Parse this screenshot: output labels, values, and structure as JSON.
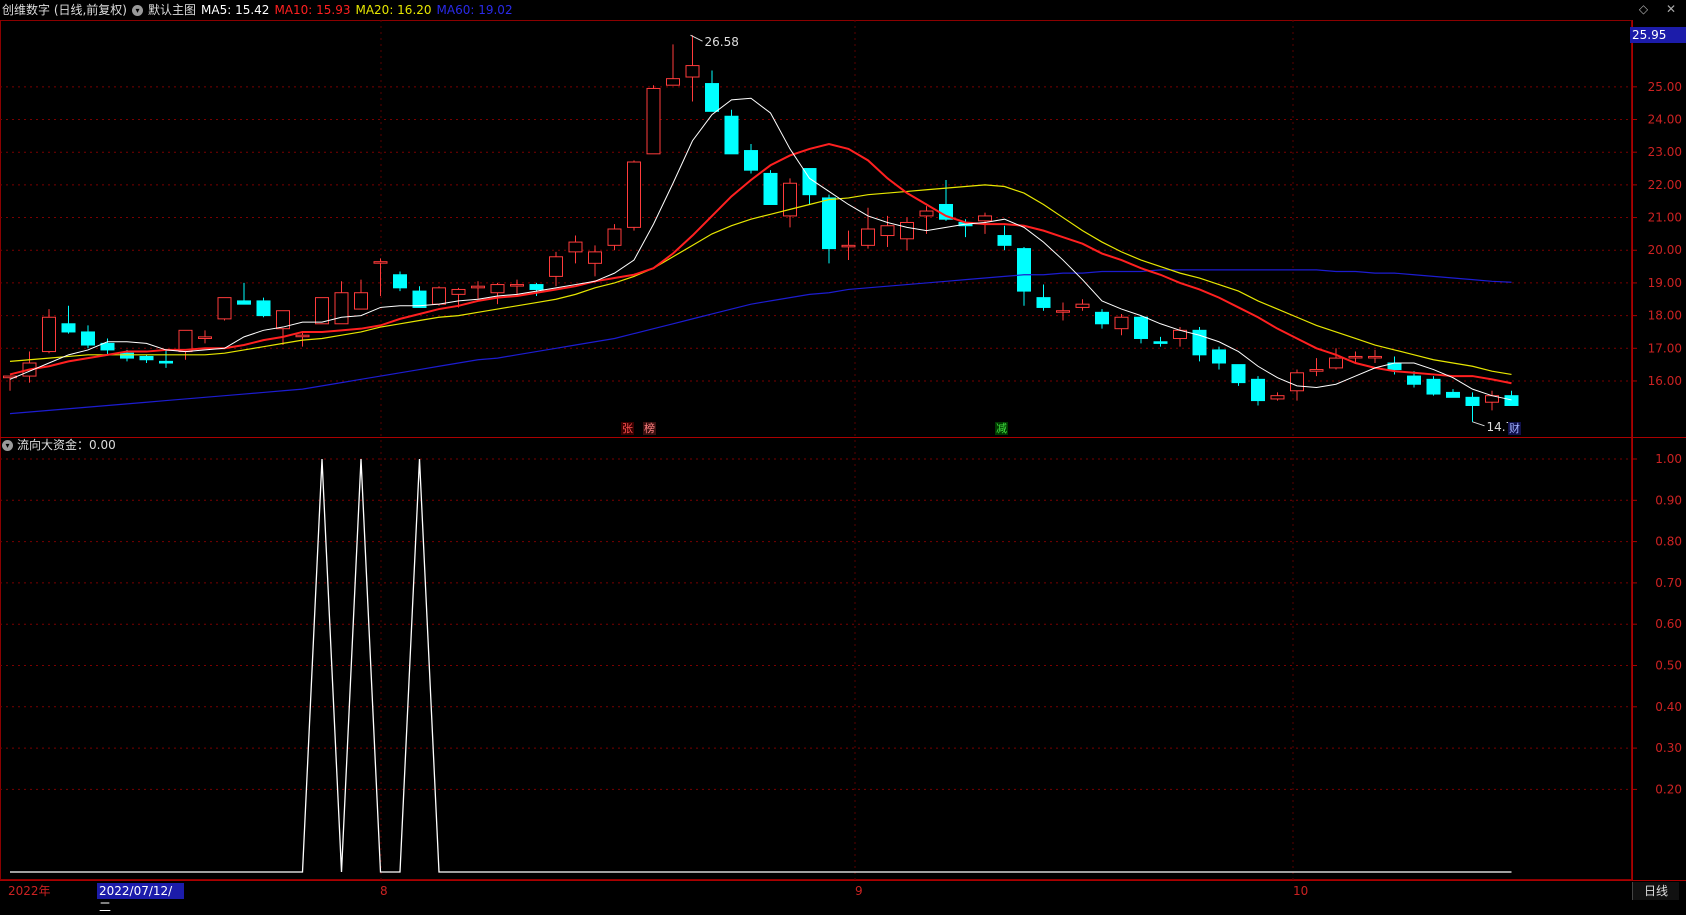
{
  "header": {
    "title": "创维数字 (日线,前复权)",
    "template": "默认主图",
    "ma5": {
      "label": "MA5: 15.42",
      "color": "#ffffff"
    },
    "ma10": {
      "label": "MA10: 15.93",
      "color": "#ff2020"
    },
    "ma20": {
      "label": "MA20: 16.20",
      "color": "#e6e600"
    },
    "ma60": {
      "label": "MA60: 19.02",
      "color": "#2020e0"
    },
    "right_icons": [
      "diamond-icon",
      "close-icon"
    ]
  },
  "sub_indicator": {
    "label": "流向大资金：0.00"
  },
  "price_axis": {
    "current_badge": "25.95",
    "ticks": [
      "25.00",
      "24.00",
      "23.00",
      "22.00",
      "21.00",
      "20.00",
      "19.00",
      "18.00",
      "17.00",
      "16.00"
    ]
  },
  "sub_axis": {
    "ticks": [
      "1.00",
      "0.90",
      "0.80",
      "0.70",
      "0.60",
      "0.50",
      "0.40",
      "0.30",
      "0.20"
    ]
  },
  "annotations": {
    "high": "26.58",
    "low": "14.75",
    "events": [
      {
        "text": "张",
        "color": "#ff5050",
        "bg": "#3a0000"
      },
      {
        "text": "榜",
        "color": "#ff8080",
        "bg": "#3a1010"
      },
      {
        "text": "减",
        "color": "#40e040",
        "bg": "#003a00"
      },
      {
        "text": "财",
        "color": "#a0b0ff",
        "bg": "#10104a"
      }
    ]
  },
  "date_axis": {
    "year": "2022年",
    "cursor_date": "2022/07/12/二",
    "months": [
      "8",
      "9",
      "10"
    ]
  },
  "period_tab": "日线",
  "chart_data": {
    "type": "candlestick",
    "colors": {
      "up": "#ff3b3b",
      "down": "#00ffff",
      "ma5": "#ffffff",
      "ma10": "#ff2020",
      "ma20": "#e6e600",
      "ma60": "#1c1cd0"
    },
    "candles": [
      [
        16.1,
        16.15,
        15.7,
        16.15
      ],
      [
        16.15,
        16.9,
        15.95,
        16.55
      ],
      [
        16.9,
        18.2,
        16.85,
        17.95
      ],
      [
        17.75,
        18.3,
        17.45,
        17.5
      ],
      [
        17.5,
        17.7,
        17.0,
        17.1
      ],
      [
        17.15,
        17.3,
        16.8,
        16.95
      ],
      [
        16.85,
        16.95,
        16.6,
        16.7
      ],
      [
        16.75,
        16.8,
        16.55,
        16.65
      ],
      [
        16.6,
        16.95,
        16.4,
        16.55
      ],
      [
        16.9,
        17.55,
        16.65,
        17.55
      ],
      [
        17.3,
        17.55,
        17.15,
        17.35
      ],
      [
        17.9,
        18.55,
        17.85,
        18.55
      ],
      [
        18.45,
        19.0,
        18.35,
        18.35
      ],
      [
        18.45,
        18.55,
        17.95,
        18.0
      ],
      [
        17.6,
        18.15,
        17.1,
        18.15
      ],
      [
        17.4,
        17.5,
        17.05,
        17.4
      ],
      [
        17.75,
        18.55,
        17.75,
        18.55
      ],
      [
        17.75,
        19.05,
        17.75,
        18.7
      ],
      [
        18.2,
        19.1,
        18.2,
        18.7
      ],
      [
        19.65,
        19.75,
        18.6,
        19.65
      ],
      [
        19.25,
        19.35,
        18.75,
        18.85
      ],
      [
        18.75,
        18.9,
        18.3,
        18.25
      ],
      [
        18.35,
        18.9,
        18.3,
        18.85
      ],
      [
        18.65,
        18.85,
        18.25,
        18.8
      ],
      [
        18.85,
        19.05,
        18.5,
        18.9
      ],
      [
        18.7,
        19.0,
        18.35,
        18.95
      ],
      [
        18.95,
        19.1,
        18.6,
        18.95
      ],
      [
        18.95,
        19.0,
        18.6,
        18.8
      ],
      [
        19.2,
        19.95,
        18.9,
        19.8
      ],
      [
        19.95,
        20.45,
        19.6,
        20.25
      ],
      [
        19.6,
        20.15,
        19.2,
        19.95
      ],
      [
        20.15,
        20.8,
        20.0,
        20.65
      ],
      [
        20.7,
        22.75,
        20.6,
        22.7
      ],
      [
        22.95,
        25.05,
        22.95,
        24.95
      ],
      [
        25.05,
        26.3,
        25.05,
        25.25
      ],
      [
        25.3,
        26.58,
        24.55,
        25.65
      ],
      [
        25.1,
        25.5,
        24.45,
        24.25
      ],
      [
        24.1,
        24.3,
        23.1,
        22.95
      ],
      [
        23.05,
        23.25,
        22.35,
        22.45
      ],
      [
        22.35,
        22.45,
        21.4,
        21.4
      ],
      [
        21.05,
        22.2,
        20.7,
        22.05
      ],
      [
        22.5,
        22.5,
        21.4,
        21.7
      ],
      [
        21.6,
        21.7,
        19.6,
        20.05
      ],
      [
        20.15,
        20.6,
        19.7,
        20.15
      ],
      [
        20.15,
        21.3,
        20.05,
        20.65
      ],
      [
        20.45,
        21.05,
        20.1,
        20.75
      ],
      [
        20.35,
        21.0,
        20.0,
        20.85
      ],
      [
        21.05,
        21.35,
        20.5,
        21.2
      ],
      [
        21.4,
        22.15,
        20.9,
        20.95
      ],
      [
        20.85,
        20.95,
        20.4,
        20.75
      ],
      [
        20.9,
        21.15,
        20.5,
        21.05
      ],
      [
        20.45,
        20.75,
        20.0,
        20.15
      ],
      [
        20.05,
        20.1,
        18.3,
        18.75
      ],
      [
        18.55,
        18.95,
        18.15,
        18.25
      ],
      [
        18.15,
        18.4,
        17.85,
        18.15
      ],
      [
        18.25,
        18.5,
        18.15,
        18.35
      ],
      [
        18.1,
        18.2,
        17.6,
        17.75
      ],
      [
        17.6,
        18.05,
        17.4,
        17.95
      ],
      [
        17.95,
        18.0,
        17.15,
        17.3
      ],
      [
        17.2,
        17.35,
        17.05,
        17.15
      ],
      [
        17.3,
        17.65,
        17.05,
        17.55
      ],
      [
        17.55,
        17.65,
        16.6,
        16.8
      ],
      [
        16.95,
        17.05,
        16.35,
        16.55
      ],
      [
        16.5,
        16.5,
        15.85,
        15.95
      ],
      [
        16.05,
        16.15,
        15.25,
        15.4
      ],
      [
        15.45,
        15.65,
        15.4,
        15.55
      ],
      [
        15.7,
        16.35,
        15.4,
        16.25
      ],
      [
        16.3,
        16.7,
        16.15,
        16.35
      ],
      [
        16.4,
        17.0,
        16.35,
        16.7
      ],
      [
        16.75,
        16.9,
        16.55,
        16.75
      ],
      [
        16.75,
        16.95,
        16.55,
        16.75
      ],
      [
        16.55,
        16.75,
        16.2,
        16.35
      ],
      [
        16.15,
        16.3,
        15.8,
        15.9
      ],
      [
        16.05,
        16.15,
        15.55,
        15.6
      ],
      [
        15.65,
        15.75,
        15.5,
        15.5
      ],
      [
        15.5,
        15.65,
        14.75,
        15.25
      ],
      [
        15.35,
        15.7,
        15.1,
        15.55
      ],
      [
        15.55,
        15.7,
        15.25,
        15.25
      ]
    ],
    "ma5": [
      16.05,
      16.3,
      16.55,
      16.8,
      16.95,
      17.2,
      17.2,
      17.15,
      16.95,
      16.9,
      16.95,
      17.0,
      17.35,
      17.55,
      17.65,
      17.8,
      17.8,
      17.95,
      18.0,
      18.25,
      18.3,
      18.3,
      18.35,
      18.45,
      18.5,
      18.6,
      18.65,
      18.75,
      18.85,
      18.95,
      19.05,
      19.3,
      19.7,
      20.8,
      22.05,
      23.35,
      24.15,
      24.6,
      24.65,
      24.2,
      23.1,
      22.2,
      21.8,
      21.4,
      21.05,
      20.85,
      20.7,
      20.6,
      20.7,
      20.8,
      20.85,
      20.95,
      20.7,
      20.25,
      19.7,
      19.1,
      18.45,
      18.2,
      18.0,
      17.75,
      17.55,
      17.4,
      17.2,
      16.9,
      16.45,
      16.1,
      15.85,
      15.8,
      15.9,
      16.15,
      16.4,
      16.55,
      16.55,
      16.35,
      16.1,
      15.75,
      15.55,
      15.42
    ],
    "ma10": [
      16.2,
      16.35,
      16.45,
      16.6,
      16.7,
      16.8,
      16.9,
      16.9,
      16.95,
      16.95,
      17.0,
      17.0,
      17.1,
      17.25,
      17.35,
      17.5,
      17.5,
      17.55,
      17.6,
      17.7,
      17.9,
      18.05,
      18.2,
      18.3,
      18.45,
      18.55,
      18.6,
      18.7,
      18.8,
      18.9,
      19.05,
      19.15,
      19.25,
      19.45,
      19.9,
      20.45,
      21.05,
      21.65,
      22.15,
      22.6,
      22.9,
      23.1,
      23.25,
      23.1,
      22.75,
      22.2,
      21.75,
      21.4,
      21.05,
      20.85,
      20.8,
      20.8,
      20.75,
      20.6,
      20.4,
      20.2,
      19.9,
      19.7,
      19.45,
      19.25,
      19.0,
      18.8,
      18.55,
      18.25,
      17.95,
      17.6,
      17.3,
      17.0,
      16.8,
      16.55,
      16.4,
      16.3,
      16.25,
      16.2,
      16.15,
      16.15,
      16.05,
      15.93
    ],
    "ma20": [
      16.6,
      16.65,
      16.7,
      16.75,
      16.8,
      16.8,
      16.8,
      16.8,
      16.8,
      16.8,
      16.8,
      16.85,
      16.95,
      17.05,
      17.15,
      17.25,
      17.3,
      17.4,
      17.5,
      17.65,
      17.75,
      17.85,
      17.95,
      18.0,
      18.1,
      18.2,
      18.3,
      18.4,
      18.5,
      18.65,
      18.85,
      19.0,
      19.2,
      19.45,
      19.8,
      20.15,
      20.5,
      20.75,
      20.95,
      21.1,
      21.25,
      21.4,
      21.55,
      21.6,
      21.7,
      21.75,
      21.8,
      21.85,
      21.9,
      21.95,
      22.0,
      21.95,
      21.75,
      21.4,
      21.0,
      20.6,
      20.25,
      19.95,
      19.7,
      19.5,
      19.3,
      19.15,
      18.95,
      18.75,
      18.45,
      18.2,
      17.95,
      17.7,
      17.5,
      17.3,
      17.1,
      16.95,
      16.8,
      16.65,
      16.55,
      16.45,
      16.3,
      16.2
    ],
    "ma60": [
      15.0,
      15.05,
      15.1,
      15.15,
      15.2,
      15.25,
      15.3,
      15.35,
      15.4,
      15.45,
      15.5,
      15.55,
      15.6,
      15.65,
      15.7,
      15.75,
      15.85,
      15.95,
      16.05,
      16.15,
      16.25,
      16.35,
      16.45,
      16.55,
      16.65,
      16.7,
      16.8,
      16.9,
      17.0,
      17.1,
      17.2,
      17.3,
      17.45,
      17.6,
      17.75,
      17.9,
      18.05,
      18.2,
      18.35,
      18.45,
      18.55,
      18.65,
      18.7,
      18.8,
      18.85,
      18.9,
      18.95,
      19.0,
      19.05,
      19.1,
      19.15,
      19.2,
      19.25,
      19.25,
      19.3,
      19.3,
      19.35,
      19.35,
      19.35,
      19.4,
      19.4,
      19.4,
      19.4,
      19.4,
      19.4,
      19.4,
      19.4,
      19.4,
      19.35,
      19.35,
      19.3,
      19.3,
      19.25,
      19.2,
      19.15,
      19.1,
      19.05,
      19.02
    ],
    "indicator": [
      0,
      0,
      0,
      0,
      0,
      0,
      0,
      0,
      0,
      0,
      0,
      0,
      0,
      0,
      0,
      0,
      1,
      0,
      1,
      0,
      0,
      1,
      0,
      0,
      0,
      0,
      0,
      0,
      0,
      0,
      0,
      0,
      0,
      0,
      0,
      0,
      0,
      0,
      0,
      0,
      0,
      0,
      0,
      0,
      0,
      0,
      0,
      0,
      0,
      0,
      0,
      0,
      0,
      0,
      0,
      0,
      0,
      0,
      0,
      0,
      0,
      0,
      0,
      0,
      0,
      0,
      0,
      0,
      0,
      0,
      0,
      0,
      0,
      0,
      0,
      0,
      0,
      0
    ],
    "ylim_price": [
      14.5,
      26.8
    ],
    "ylim_indicator": [
      0,
      1.0
    ]
  }
}
